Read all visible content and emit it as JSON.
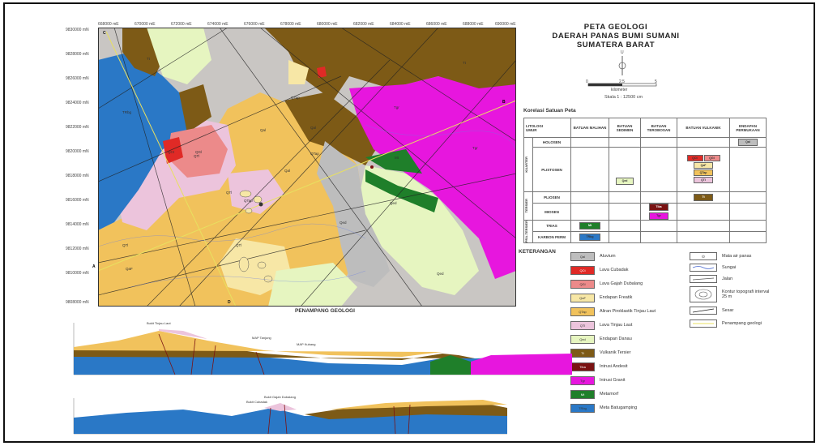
{
  "map_title": [
    "PETA GEOLOGI",
    "DAERAH PANAS BUMI SUMANI",
    "SUMATERA BARAT"
  ],
  "scale": {
    "ticks": [
      "0",
      "2.5",
      "5"
    ],
    "unit": "kilometer",
    "text": "Skala 1 : 12500 cm",
    "north": "U"
  },
  "grid": {
    "x_ticks": [
      "668000 mE",
      "670000 mE",
      "672000 mE",
      "674000 mE",
      "676000 mE",
      "678000 mE",
      "680000 mE",
      "682000 mE",
      "684000 mE",
      "686000 mE",
      "688000 mE",
      "690000 mE"
    ],
    "y_ticks": [
      "9830000 mN",
      "9828000 mN",
      "9826000 mN",
      "9824000 mN",
      "9822000 mN",
      "9820000 mN",
      "9818000 mN",
      "9816000 mN",
      "9814000 mN",
      "9812000 mN",
      "9810000 mN",
      "9808000 mN"
    ]
  },
  "section_labels": {
    "a": "A",
    "b": "B",
    "c": "C",
    "d": "D"
  },
  "korelasi": {
    "title": "Korelasi Satuan Peta",
    "headers": [
      "LITOLOGI",
      "UMUR",
      "BATUAN MALIHAN",
      "BATUAN SEDIMEN",
      "BATUAN TEROBOSAN",
      "BATUAN VULKANIK",
      "ENDAPAN PERMUKAAN"
    ],
    "eras": [
      "KUARTER",
      "TERSIER",
      "PRA-TERSIER"
    ],
    "epochs": [
      "HOLOSEN",
      "PLISTOSEN",
      "PLIOSEN",
      "MIOSEN",
      "TRIAS",
      "KARBON PERM"
    ]
  },
  "keterangan_title": "KETERANGAN",
  "legend": [
    {
      "code": "Qal",
      "label": "Aluvium",
      "color": "#bdbdbd"
    },
    {
      "code": "QCt",
      "label": "Lava Cubadak",
      "color": "#e02a26"
    },
    {
      "code": "QGl",
      "label": "Lava Gajah Dubalang",
      "color": "#ec8a8a"
    },
    {
      "code": "QaF",
      "label": "Endapan Freatik",
      "color": "#f7e7a6"
    },
    {
      "code": "QTap",
      "label": "Aliran Piroklastik Tinjau Laut",
      "color": "#f1c25c"
    },
    {
      "code": "QTl",
      "label": "Lava Tinjau Laut",
      "color": "#ecc4dc"
    },
    {
      "code": "Qed",
      "label": "Endapan Danau",
      "color": "#e6f5c0"
    },
    {
      "code": "Tt",
      "label": "Vulkanik Tersier",
      "color": "#7d5a16"
    },
    {
      "code": "Tiba",
      "label": "Intrusi Andesit",
      "color": "#7a1212"
    },
    {
      "code": "Tgr",
      "label": "Intrusi Granit",
      "color": "#e716de"
    },
    {
      "code": "Mt",
      "label": "Metamorf",
      "color": "#1f7f2a"
    },
    {
      "code": "TRbg",
      "label": "Meta Batugamping",
      "color": "#2a78c6"
    }
  ],
  "symbols": [
    {
      "label": "Mata air panas"
    },
    {
      "label": "Sungai"
    },
    {
      "label": "Jalan"
    },
    {
      "label": "Kontur topografi interval 25 m"
    },
    {
      "label": "Sesar"
    },
    {
      "label": "Penampang geologi"
    }
  ],
  "penampang_title": "PENAMPANG GEOLOGI",
  "cross_section_labels": [
    "Bukit Tinjau Laut",
    "MAP Tanjung",
    "MAP Kubang",
    "Bukit Gajah Dubalang",
    "Bukit Cubadak"
  ],
  "map_labels": [
    "Tt",
    "Tt",
    "QTap",
    "Qal",
    "QTl",
    "QTap",
    "QTl",
    "QCt",
    "QGl",
    "Qal",
    "Tgr",
    "Tgr",
    "Mt",
    "Qed",
    "Qed",
    "QTap",
    "QTl",
    "QaF",
    "TRbg",
    "Qed",
    "Qal",
    "QTl"
  ]
}
